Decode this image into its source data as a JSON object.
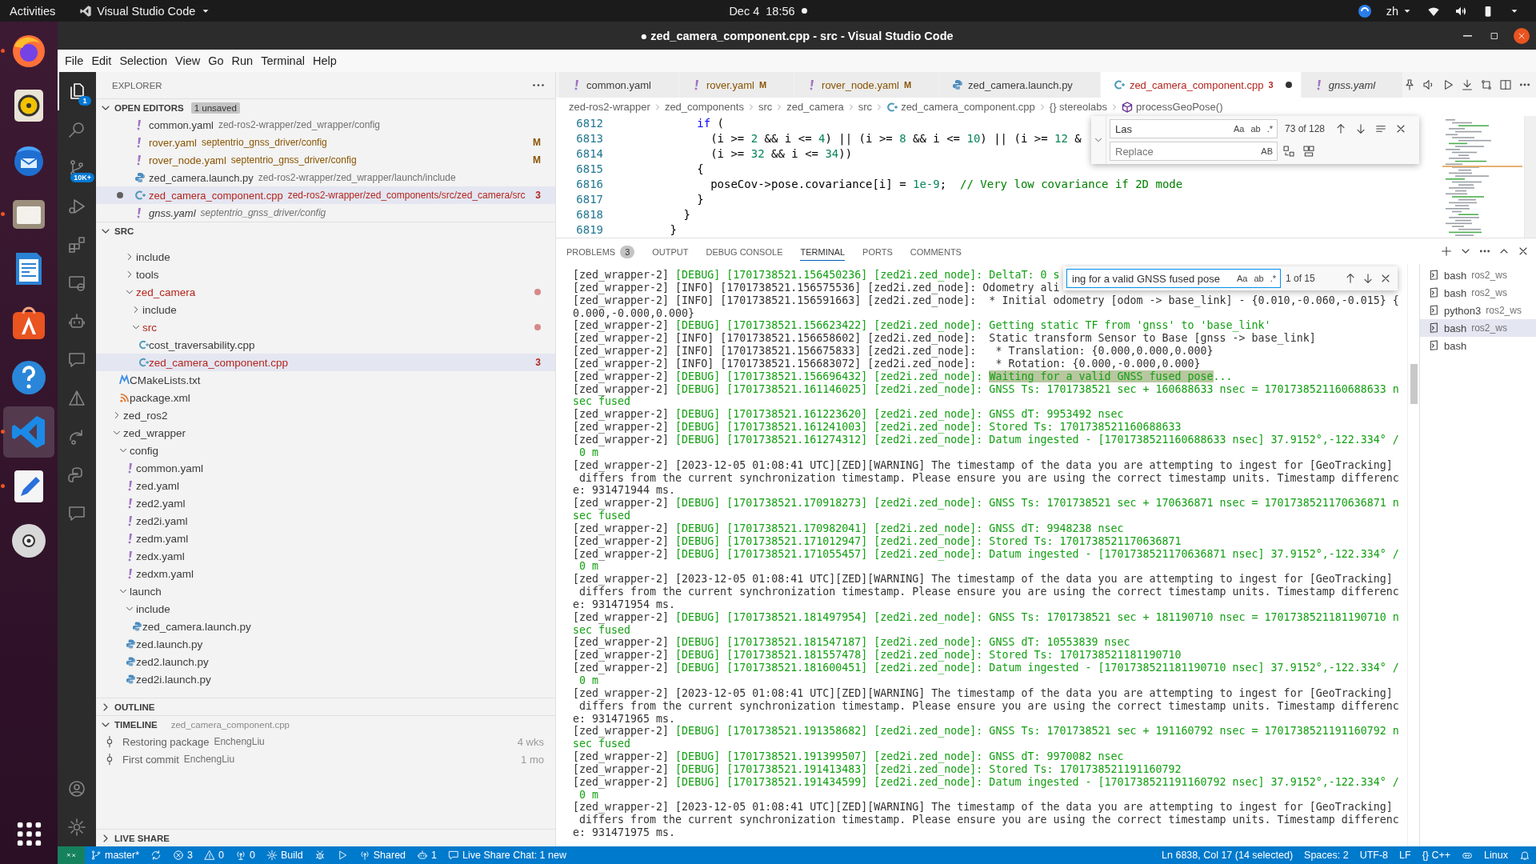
{
  "top_bar": {
    "activities": "Activities",
    "app_menu": "Visual Studio Code",
    "clock": "Dec 4  18:56",
    "input_source": "zh"
  },
  "dock": [
    {
      "kind": "browser",
      "running": true,
      "selected": false
    },
    {
      "kind": "speaker",
      "running": false,
      "selected": false
    },
    {
      "kind": "mail",
      "running": false,
      "selected": false
    },
    {
      "kind": "folder",
      "running": true,
      "selected": false
    },
    {
      "kind": "document",
      "running": false,
      "selected": false
    },
    {
      "kind": "shopping-bag",
      "running": false,
      "selected": false
    },
    {
      "kind": "help",
      "running": false,
      "selected": false
    },
    {
      "kind": "code-editor",
      "running": true,
      "selected": true
    },
    {
      "kind": "text-editor",
      "running": true,
      "selected": false
    },
    {
      "kind": "disc",
      "running": false,
      "selected": false
    }
  ],
  "window": {
    "title": "● zed_camera_component.cpp - src - Visual Studio Code"
  },
  "menu": [
    "File",
    "Edit",
    "Selection",
    "View",
    "Go",
    "Run",
    "Terminal",
    "Help"
  ],
  "activity_bar": [
    {
      "kind": "files",
      "selected": true,
      "badge": "1"
    },
    {
      "kind": "search",
      "selected": false
    },
    {
      "kind": "source-control",
      "selected": false,
      "badge": "10K+"
    },
    {
      "kind": "run-debug",
      "selected": false
    },
    {
      "kind": "extensions",
      "selected": false
    },
    {
      "kind": "remote-explorer",
      "selected": false
    },
    {
      "kind": "robot",
      "selected": false
    },
    {
      "kind": "chat",
      "selected": false
    },
    {
      "kind": "triangle",
      "selected": false
    },
    {
      "kind": "share",
      "selected": false
    },
    {
      "kind": "snake",
      "selected": false
    },
    {
      "kind": "chat",
      "selected": false
    }
  ],
  "sidebar": {
    "title": "EXPLORER",
    "open_editors": {
      "title": "OPEN EDITORS",
      "badge": "1 unsaved",
      "expanded": true,
      "items": [
        {
          "name": "common.yaml",
          "path": "zed-ros2-wrapper/zed_wrapper/config",
          "kind": "yaml",
          "modified": false,
          "errors": false,
          "dirty": false,
          "preview": false,
          "selected": false
        },
        {
          "name": "rover.yaml",
          "path": "septentrio_gnss_driver/config",
          "kind": "yaml",
          "modified": true,
          "errors": false,
          "badge": "M",
          "dirty": false,
          "preview": false,
          "selected": false
        },
        {
          "name": "rover_node.yaml",
          "path": "septentrio_gnss_driver/config",
          "kind": "yaml",
          "modified": true,
          "errors": false,
          "badge": "M",
          "dirty": false,
          "preview": false,
          "selected": false
        },
        {
          "name": "zed_camera.launch.py",
          "path": "zed-ros2-wrapper/zed_wrapper/launch/include",
          "kind": "python",
          "modified": false,
          "errors": false,
          "dirty": false,
          "preview": false,
          "selected": false
        },
        {
          "name": "zed_camera_component.cpp",
          "path": "zed-ros2-wrapper/zed_components/src/zed_camera/src",
          "kind": "cpp",
          "errors": true,
          "badge": "3",
          "dirty": true,
          "preview": false,
          "selected": true
        },
        {
          "name": "gnss.yaml",
          "path": "septentrio_gnss_driver/config",
          "kind": "yaml",
          "modified": false,
          "errors": false,
          "dirty": false,
          "preview": true,
          "selected": false
        }
      ]
    },
    "folder": {
      "title": "SRC",
      "expanded": true,
      "tree": [
        {
          "children": [
            {
              "children": [
                {
                  "label": "include",
                  "kind": "folder",
                  "expanded": false,
                  "errors": false,
                  "selected": false
                },
                {
                  "label": "tools",
                  "kind": "folder",
                  "expanded": false,
                  "errors": false,
                  "selected": false
                },
                {
                  "label": "zed_camera",
                  "kind": "folder",
                  "expanded": true,
                  "errors": true,
                  "selected": false,
                  "children": [
                    {
                      "label": "include",
                      "kind": "folder",
                      "expanded": false,
                      "errors": false,
                      "selected": false
                    },
                    {
                      "label": "src",
                      "kind": "folder",
                      "expanded": true,
                      "errors": true,
                      "selected": false,
                      "children": [
                        {
                          "label": "cost_traversability.cpp",
                          "kind": "cpp",
                          "errors": false,
                          "selected": false
                        },
                        {
                          "label": "zed_camera_component.cpp",
                          "kind": "cpp",
                          "errors": true,
                          "badge": "3",
                          "selected": true
                        }
                      ]
                    }
                  ]
                }
              ]
            },
            {
              "label": "CMakeLists.txt",
              "kind": "cmake",
              "errors": false,
              "selected": false
            },
            {
              "label": "package.xml",
              "kind": "xml",
              "errors": false,
              "selected": false
            }
          ]
        },
        {
          "label": "zed_ros2",
          "kind": "folder",
          "expanded": false,
          "errors": false,
          "selected": false
        },
        {
          "label": "zed_wrapper",
          "kind": "folder",
          "expanded": true,
          "errors": false,
          "selected": false,
          "children": [
            {
              "label": "config",
              "kind": "folder",
              "expanded": true,
              "errors": false,
              "selected": false,
              "children": [
                {
                  "label": "common.yaml",
                  "kind": "yaml",
                  "errors": false,
                  "selected": false
                },
                {
                  "label": "zed.yaml",
                  "kind": "yaml",
                  "errors": false,
                  "selected": false
                },
                {
                  "label": "zed2.yaml",
                  "kind": "yaml",
                  "errors": false,
                  "selected": false
                },
                {
                  "label": "zed2i.yaml",
                  "kind": "yaml",
                  "errors": false,
                  "selected": false
                },
                {
                  "label": "zedm.yaml",
                  "kind": "yaml",
                  "errors": false,
                  "selected": false
                },
                {
                  "label": "zedx.yaml",
                  "kind": "yaml",
                  "errors": false,
                  "selected": false
                },
                {
                  "label": "zedxm.yaml",
                  "kind": "yaml",
                  "errors": false,
                  "selected": false
                }
              ]
            },
            {
              "label": "launch",
              "kind": "folder",
              "expanded": true,
              "errors": false,
              "selected": false,
              "children": [
                {
                  "label": "include",
                  "kind": "folder",
                  "expanded": true,
                  "errors": false,
                  "selected": false,
                  "children": [
                    {
                      "label": "zed_camera.launch.py",
                      "kind": "python",
                      "errors": false,
                      "selected": false
                    }
                  ]
                },
                {
                  "label": "zed.launch.py",
                  "kind": "python",
                  "errors": false,
                  "selected": false
                },
                {
                  "label": "zed2.launch.py",
                  "kind": "python",
                  "errors": false,
                  "selected": false
                },
                {
                  "label": "zed2i.launch.py",
                  "kind": "python",
                  "errors": false,
                  "selected": false
                }
              ]
            }
          ]
        }
      ]
    },
    "outline": {
      "title": "OUTLINE",
      "expanded": false
    },
    "timeline": {
      "title": "TIMELINE",
      "expanded": true,
      "file": "zed_camera_component.cpp",
      "items": [
        {
          "message": "Restoring package",
          "author": "EnchengLiu",
          "age": "4 wks"
        },
        {
          "message": "First commit",
          "author": "EnchengLiu",
          "age": "1 mo"
        }
      ]
    },
    "live_share": {
      "title": "LIVE SHARE",
      "expanded": false
    }
  },
  "tabs": [
    {
      "label": "common.yaml",
      "kind": "yaml",
      "modified": false,
      "errors": false,
      "dirty": false,
      "preview": false,
      "selected": false
    },
    {
      "label": "rover.yaml",
      "kind": "yaml",
      "modified": true,
      "errors": false,
      "badge": "M",
      "dirty": false,
      "preview": false,
      "selected": false
    },
    {
      "label": "rover_node.yaml",
      "kind": "yaml",
      "modified": true,
      "errors": false,
      "badge": "M",
      "dirty": false,
      "preview": false,
      "selected": false
    },
    {
      "label": "zed_camera.launch.py",
      "kind": "python",
      "modified": false,
      "errors": false,
      "dirty": false,
      "preview": false,
      "selected": false
    },
    {
      "label": "zed_camera_component.cpp",
      "kind": "cpp",
      "errors": true,
      "badge": "3",
      "dirty": true,
      "preview": false,
      "selected": true
    },
    {
      "label": "gnss.yaml",
      "kind": "yaml",
      "modified": false,
      "errors": false,
      "dirty": false,
      "preview": true,
      "selected": false
    }
  ],
  "breadcrumbs": [
    {
      "label": "zed-ros2-wrapper"
    },
    {
      "label": "zed_components"
    },
    {
      "label": "src"
    },
    {
      "label": "zed_camera"
    },
    {
      "label": "src"
    },
    {
      "label": "zed_camera_component.cpp",
      "kind": "cpp"
    },
    {
      "label": "{} stereolabs"
    },
    {
      "label": "processGeoPose()",
      "kind": "method"
    }
  ],
  "editor": {
    "lines": [
      {
        "number": "6812",
        "tokens": [
          {
            "text": "          if",
            "kind": "keyword"
          },
          {
            "text": " (",
            "kind": "plain"
          }
        ]
      },
      {
        "number": "6813",
        "tokens": [
          {
            "text": "            (i >= ",
            "kind": "plain"
          },
          {
            "text": "2",
            "kind": "number"
          },
          {
            "text": " && i <= ",
            "kind": "plain"
          },
          {
            "text": "4",
            "kind": "number"
          },
          {
            "text": ") || (i >= ",
            "kind": "plain"
          },
          {
            "text": "8",
            "kind": "number"
          },
          {
            "text": " && i <= ",
            "kind": "plain"
          },
          {
            "text": "10",
            "kind": "number"
          },
          {
            "text": ") || (i >= ",
            "kind": "plain"
          },
          {
            "text": "12",
            "kind": "number"
          },
          {
            "text": " &",
            "kind": "plain"
          }
        ]
      },
      {
        "number": "6814",
        "tokens": [
          {
            "text": "            (i >= ",
            "kind": "plain"
          },
          {
            "text": "32",
            "kind": "number"
          },
          {
            "text": " && i <= ",
            "kind": "plain"
          },
          {
            "text": "34",
            "kind": "number"
          },
          {
            "text": "))",
            "kind": "plain"
          }
        ]
      },
      {
        "number": "6815",
        "tokens": [
          {
            "text": "          {",
            "kind": "plain"
          }
        ]
      },
      {
        "number": "6816",
        "tokens": [
          {
            "text": "            poseCov->pose.covariance[i] = ",
            "kind": "plain"
          },
          {
            "text": "1e-9",
            "kind": "number"
          },
          {
            "text": ";  ",
            "kind": "plain"
          },
          {
            "text": "// Very low covariance if 2D mode",
            "kind": "comment"
          }
        ]
      },
      {
        "number": "6817",
        "tokens": [
          {
            "text": "          }",
            "kind": "plain"
          }
        ]
      },
      {
        "number": "6818",
        "tokens": [
          {
            "text": "        }",
            "kind": "plain"
          }
        ]
      },
      {
        "number": "6819",
        "tokens": [
          {
            "text": "      }",
            "kind": "plain"
          }
        ]
      }
    ],
    "find": {
      "query": "Las",
      "options": [
        "Aa",
        "ab",
        ".*"
      ],
      "count": "73 of 128",
      "replace_placeholder": "Replace",
      "preserve_case": "AB"
    }
  },
  "panel": {
    "tabs": [
      {
        "label": "PROBLEMS",
        "badge": "3",
        "selected": false
      },
      {
        "label": "OUTPUT",
        "selected": false
      },
      {
        "label": "DEBUG CONSOLE",
        "selected": false
      },
      {
        "label": "TERMINAL",
        "selected": true
      },
      {
        "label": "PORTS",
        "selected": false
      },
      {
        "label": "COMMENTS",
        "selected": false
      }
    ],
    "terminal": {
      "find": {
        "query": "ing for a valid GNSS fused pose",
        "options": [
          "Aa",
          "ab",
          ".*"
        ],
        "count": "1 of 15"
      },
      "rows": [
        {
          "source": "[zed_wrapper-2]",
          "text": "[DEBUG] [1701738521.156450236] [zed2i.zed_node]: DeltaT: 0 s",
          "kind": "debug"
        },
        {
          "source": "[zed_wrapper-2]",
          "text": "[INFO] [1701738521.156575536] [zed2i.zed_node]: Odometry ali",
          "kind": "info"
        },
        {
          "source": "[zed_wrapper-2]",
          "text": "[INFO] [1701738521.156591663] [zed2i.zed_node]:  * Initial odometry [odom -> base_link] - {0.010,-0.060,-0.015} {",
          "kind": "info"
        },
        {
          "text": "0.000,-0.000,0.000}",
          "kind": "info"
        },
        {
          "source": "[zed_wrapper-2]",
          "text": "[DEBUG] [1701738521.156623422] [zed2i.zed_node]: Getting static TF from 'gnss' to 'base_link'",
          "kind": "debug"
        },
        {
          "source": "[zed_wrapper-2]",
          "text": "[INFO] [1701738521.156658602] [zed2i.zed_node]:  Static transform Sensor to Base [gnss -> base_link]",
          "kind": "info"
        },
        {
          "source": "[zed_wrapper-2]",
          "text": "[INFO] [1701738521.156675833] [zed2i.zed_node]:   * Translation: {0.000,0.000,0.000}",
          "kind": "info"
        },
        {
          "source": "[zed_wrapper-2]",
          "text": "[INFO] [1701738521.156683072] [zed2i.zed_node]:   * Rotation: {0.000,-0.000,0.000}",
          "kind": "info"
        },
        {
          "source": "[zed_wrapper-2]",
          "text": "[DEBUG] [1701738521.156696432] [zed2i.zed_node]:",
          "match": "Waiting for a valid GNSS fused pose",
          "rest": "...",
          "kind": "debug"
        },
        {
          "source": "[zed_wrapper-2]",
          "text": "[DEBUG] [1701738521.161146025] [zed2i.zed_node]: GNSS Ts: 1701738521 sec + 160688633 nsec = 1701738521160688633 n",
          "kind": "debug"
        },
        {
          "text": "sec fused",
          "kind": "debug"
        },
        {
          "source": "[zed_wrapper-2]",
          "text": "[DEBUG] [1701738521.161223620] [zed2i.zed_node]: GNSS dT: 9953492 nsec",
          "kind": "debug"
        },
        {
          "source": "[zed_wrapper-2]",
          "text": "[DEBUG] [1701738521.161241003] [zed2i.zed_node]: Stored Ts: 1701738521160688633",
          "kind": "debug"
        },
        {
          "source": "[zed_wrapper-2]",
          "text": "[DEBUG] [1701738521.161274312] [zed2i.zed_node]: Datum ingested - [1701738521160688633 nsec] 37.9152°,-122.334° /",
          "kind": "debug"
        },
        {
          "text": " 0 m",
          "kind": "debug"
        },
        {
          "source": "[zed_wrapper-2]",
          "text": "[2023-12-05 01:08:41 UTC][ZED][WARNING] The timestamp of the data you are attempting to ingest for [GeoTracking]",
          "kind": "warning"
        },
        {
          "text": " differs from the current synchronization timestamp. Please ensure you are using the correct timestamp units. Timestamp differenc",
          "kind": "warning"
        },
        {
          "text": "e: 931471944 ms.",
          "kind": "warning"
        },
        {
          "source": "[zed_wrapper-2]",
          "text": "[DEBUG] [1701738521.170918273] [zed2i.zed_node]: GNSS Ts: 1701738521 sec + 170636871 nsec = 1701738521170636871 n",
          "kind": "debug"
        },
        {
          "text": "sec fused",
          "kind": "debug"
        },
        {
          "source": "[zed_wrapper-2]",
          "text": "[DEBUG] [1701738521.170982041] [zed2i.zed_node]: GNSS dT: 9948238 nsec",
          "kind": "debug"
        },
        {
          "source": "[zed_wrapper-2]",
          "text": "[DEBUG] [1701738521.171012947] [zed2i.zed_node]: Stored Ts: 1701738521170636871",
          "kind": "debug"
        },
        {
          "source": "[zed_wrapper-2]",
          "text": "[DEBUG] [1701738521.171055457] [zed2i.zed_node]: Datum ingested - [1701738521170636871 nsec] 37.9152°,-122.334° /",
          "kind": "debug"
        },
        {
          "text": " 0 m",
          "kind": "debug"
        },
        {
          "source": "[zed_wrapper-2]",
          "text": "[2023-12-05 01:08:41 UTC][ZED][WARNING] The timestamp of the data you are attempting to ingest for [GeoTracking]",
          "kind": "warning"
        },
        {
          "text": " differs from the current synchronization timestamp. Please ensure you are using the correct timestamp units. Timestamp differenc",
          "kind": "warning"
        },
        {
          "text": "e: 931471954 ms.",
          "kind": "warning"
        },
        {
          "source": "[zed_wrapper-2]",
          "text": "[DEBUG] [1701738521.181497954] [zed2i.zed_node]: GNSS Ts: 1701738521 sec + 181190710 nsec = 1701738521181190710 n",
          "kind": "debug"
        },
        {
          "text": "sec fused",
          "kind": "debug"
        },
        {
          "source": "[zed_wrapper-2]",
          "text": "[DEBUG] [1701738521.181547187] [zed2i.zed_node]: GNSS dT: 10553839 nsec",
          "kind": "debug"
        },
        {
          "source": "[zed_wrapper-2]",
          "text": "[DEBUG] [1701738521.181557478] [zed2i.zed_node]: Stored Ts: 1701738521181190710",
          "kind": "debug"
        },
        {
          "source": "[zed_wrapper-2]",
          "text": "[DEBUG] [1701738521.181600451] [zed2i.zed_node]: Datum ingested - [1701738521181190710 nsec] 37.9152°,-122.334° /",
          "kind": "debug"
        },
        {
          "text": " 0 m",
          "kind": "debug"
        },
        {
          "source": "[zed_wrapper-2]",
          "text": "[2023-12-05 01:08:41 UTC][ZED][WARNING] The timestamp of the data you are attempting to ingest for [GeoTracking]",
          "kind": "warning"
        },
        {
          "text": " differs from the current synchronization timestamp. Please ensure you are using the correct timestamp units. Timestamp differenc",
          "kind": "warning"
        },
        {
          "text": "e: 931471965 ms.",
          "kind": "warning"
        },
        {
          "source": "[zed_wrapper-2]",
          "text": "[DEBUG] [1701738521.191358682] [zed2i.zed_node]: GNSS Ts: 1701738521 sec + 191160792 nsec = 1701738521191160792 n",
          "kind": "debug"
        },
        {
          "text": "sec fused",
          "kind": "debug"
        },
        {
          "source": "[zed_wrapper-2]",
          "text": "[DEBUG] [1701738521.191399507] [zed2i.zed_node]: GNSS dT: 9970082 nsec",
          "kind": "debug"
        },
        {
          "source": "[zed_wrapper-2]",
          "text": "[DEBUG] [1701738521.191413483] [zed2i.zed_node]: Stored Ts: 1701738521191160792",
          "kind": "debug"
        },
        {
          "source": "[zed_wrapper-2]",
          "text": "[DEBUG] [1701738521.191434599] [zed2i.zed_node]: Datum ingested - [1701738521191160792 nsec] 37.9152°,-122.334° /",
          "kind": "debug"
        },
        {
          "text": " 0 m",
          "kind": "debug"
        },
        {
          "source": "[zed_wrapper-2]",
          "text": "[2023-12-05 01:08:41 UTC][ZED][WARNING] The timestamp of the data you are attempting to ingest for [GeoTracking]",
          "kind": "warning"
        },
        {
          "text": " differs from the current synchronization timestamp. Please ensure you are using the correct timestamp units. Timestamp differenc",
          "kind": "warning"
        },
        {
          "text": "e: 931471975 ms.",
          "kind": "warning"
        }
      ],
      "sessions": [
        {
          "name": "bash",
          "cwd": "ros2_ws",
          "selected": false
        },
        {
          "name": "bash",
          "cwd": "ros2_ws",
          "selected": false
        },
        {
          "name": "python3",
          "cwd": "ros2_ws",
          "selected": false
        },
        {
          "name": "bash",
          "cwd": "ros2_ws",
          "selected": true
        },
        {
          "name": "bash",
          "selected": false
        }
      ]
    }
  },
  "status_bar": {
    "left": [
      {
        "kind": "branch",
        "text": "master*"
      },
      {
        "kind": "sync"
      },
      {
        "kind": "error",
        "text": "3"
      },
      {
        "kind": "warning",
        "text": "0"
      },
      {
        "kind": "antenna",
        "text": "0"
      },
      {
        "kind": "gear",
        "text": "Build"
      },
      {
        "kind": "bug"
      },
      {
        "kind": "play"
      },
      {
        "kind": "broadcast",
        "text": "Shared"
      },
      {
        "kind": "robot",
        "text": "1"
      },
      {
        "kind": "chat",
        "text": "Live Share Chat: 1 new"
      }
    ],
    "right": [
      {
        "text": "Ln 6838, Col 17 (14 selected)"
      },
      {
        "text": "Spaces: 2"
      },
      {
        "text": "UTF-8"
      },
      {
        "text": "LF"
      },
      {
        "text": "{} C++"
      },
      {
        "kind": "mask"
      },
      {
        "text": "Linux"
      },
      {
        "kind": "bell"
      }
    ]
  }
}
